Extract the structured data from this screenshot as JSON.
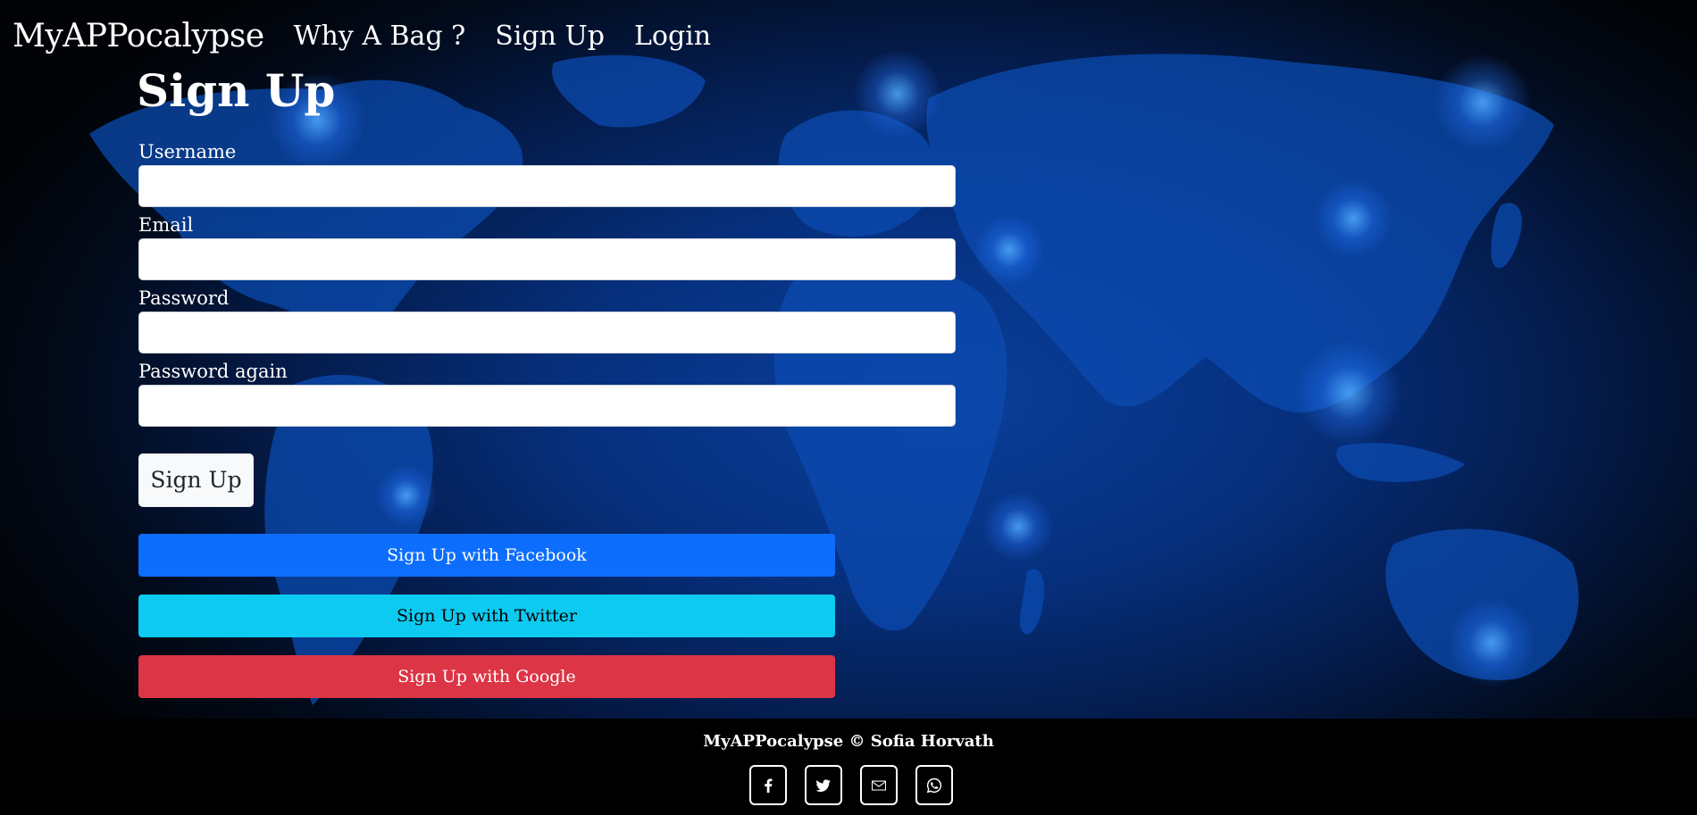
{
  "brand": "MyAPPocalypse",
  "nav": {
    "links": [
      "Why A Bag ?",
      "Sign Up",
      "Login"
    ]
  },
  "form": {
    "title": "Sign Up",
    "fields": [
      {
        "label": "Username",
        "value": ""
      },
      {
        "label": "Email",
        "value": ""
      },
      {
        "label": "Password",
        "value": ""
      },
      {
        "label": "Password again",
        "value": ""
      }
    ],
    "submit_label": "Sign Up"
  },
  "social": {
    "facebook_label": "Sign Up with Facebook",
    "twitter_label": "Sign Up with Twitter",
    "google_label": "Sign Up with Google"
  },
  "footer": {
    "text": "MyAPPocalypse © Sofia Horvath",
    "icons": [
      "facebook-icon",
      "twitter-icon",
      "mail-icon",
      "whatsapp-icon"
    ]
  },
  "colors": {
    "facebook": "#0d6efd",
    "twitter": "#0dcaf0",
    "google": "#dc3545",
    "background": "#06307e"
  }
}
